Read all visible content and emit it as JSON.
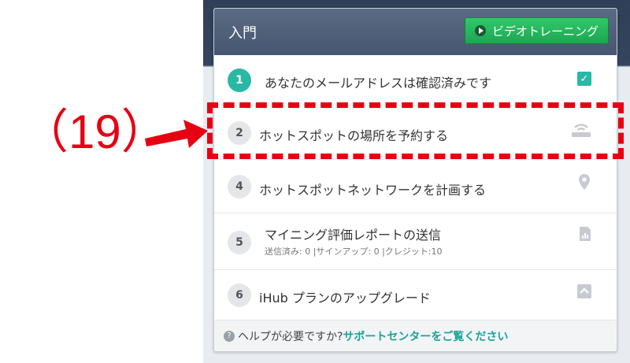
{
  "panel": {
    "title": "入門",
    "video_button_label": "ビデオトレーニング"
  },
  "steps": [
    {
      "number": "1",
      "label": "あなたのメールアドレスは確認済みです",
      "icon": "checkbox-checked-icon",
      "completed": true
    },
    {
      "number": "2",
      "label": "ホットスポットの場所を予約する",
      "icon": "router-icon",
      "completed": false
    },
    {
      "number": "4",
      "label": "ホットスポットネットワークを計画する",
      "icon": "map-pin-icon",
      "completed": false
    },
    {
      "number": "5",
      "label": "マイニング評価レポートの送信",
      "sub": "送信済み: 0 |サインアップ: 0 |クレジット:10",
      "icon": "report-icon",
      "completed": false
    },
    {
      "number": "6",
      "label": "iHub プランのアップグレード",
      "icon": "upgrade-icon",
      "completed": false
    }
  ],
  "footer": {
    "help_text": "ヘルプが必要ですか?",
    "link_text": "サポートセンターをご覧ください"
  },
  "annotation": {
    "label": "（19）",
    "color": "#e60012"
  },
  "colors": {
    "accent_teal": "#2ab8a6",
    "video_button_green": "#1fa553",
    "header_bg": "#4e5e77"
  }
}
